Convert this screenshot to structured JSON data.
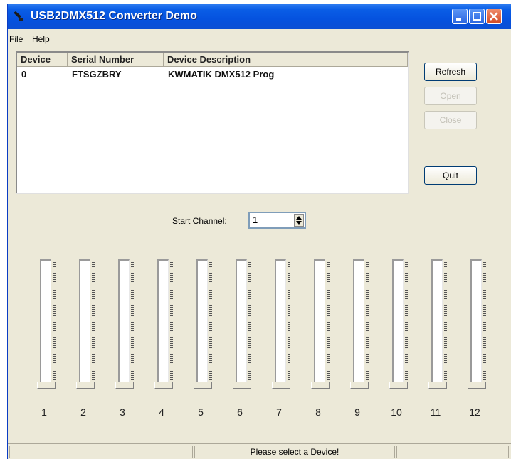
{
  "window": {
    "title": "USB2DMX512 Converter Demo"
  },
  "colors": {
    "titlebar": "#0552df",
    "face": "#ece9d8"
  },
  "menu": [
    "File",
    "Help"
  ],
  "device_list": {
    "columns": [
      "Device",
      "Serial Number",
      "Device Description"
    ],
    "rows": [
      {
        "device": "0",
        "serial": "FTSGZBRY",
        "description": "KWMATIK DMX512 Prog"
      }
    ]
  },
  "buttons": {
    "refresh": "Refresh",
    "open": "Open",
    "close": "Close",
    "quit": "Quit"
  },
  "start_channel": {
    "label": "Start Channel:",
    "value": "1"
  },
  "faders": [
    {
      "label": "1",
      "level": 0
    },
    {
      "label": "2",
      "level": 0
    },
    {
      "label": "3",
      "level": 0
    },
    {
      "label": "4",
      "level": 0
    },
    {
      "label": "5",
      "level": 0
    },
    {
      "label": "6",
      "level": 0
    },
    {
      "label": "7",
      "level": 0
    },
    {
      "label": "8",
      "level": 0
    },
    {
      "label": "9",
      "level": 0
    },
    {
      "label": "10",
      "level": 0
    },
    {
      "label": "11",
      "level": 0
    },
    {
      "label": "12",
      "level": 0
    }
  ],
  "status": {
    "message": "Please select a Device!"
  }
}
